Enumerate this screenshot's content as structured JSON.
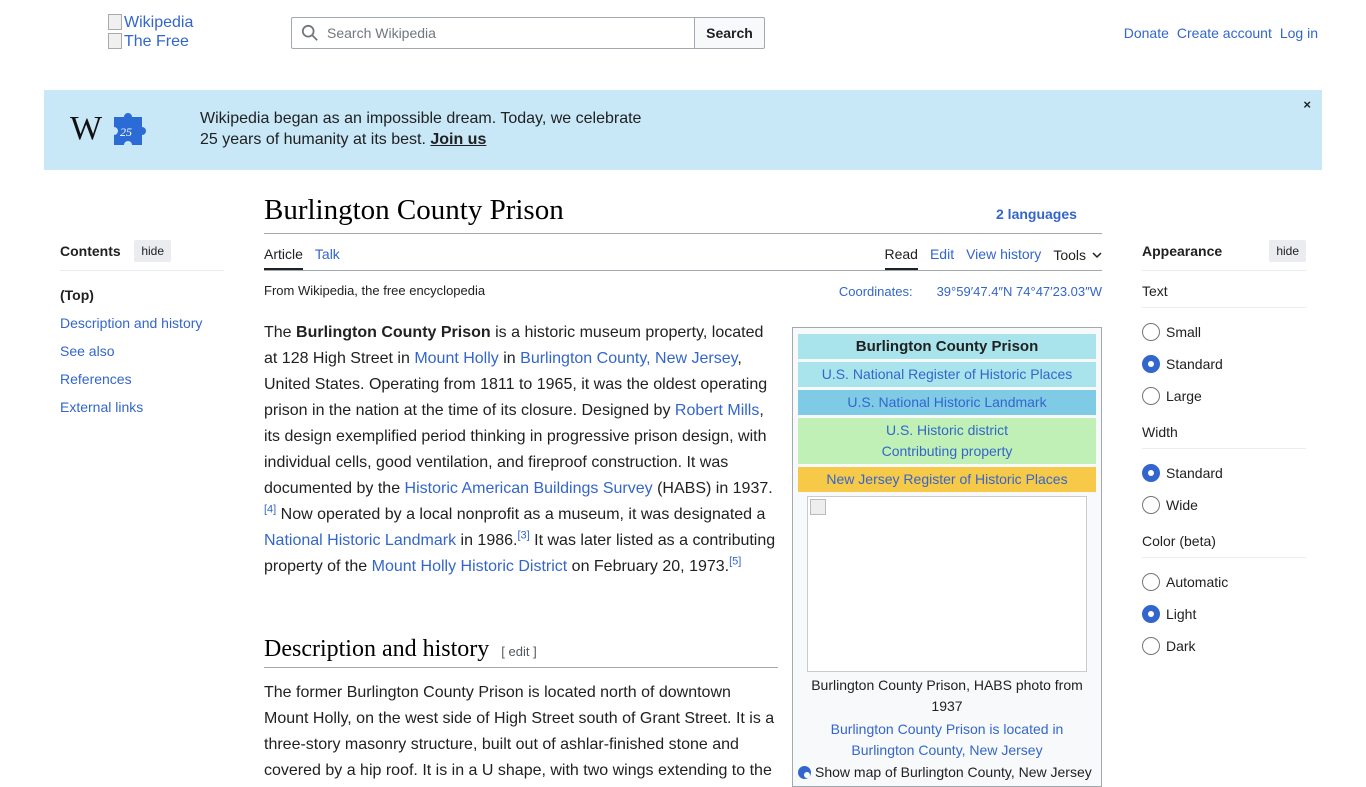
{
  "header": {
    "logo_alt_1": "Wikipedia",
    "logo_alt_2": "The Free",
    "search_placeholder": "Search Wikipedia",
    "search_button": "Search",
    "user_links": [
      "Donate",
      "Create account",
      "Log in"
    ]
  },
  "banner": {
    "line1": "Wikipedia began as an impossible dream. Today, we celebrate",
    "line2": "25 years of humanity at its best.",
    "join_link": "Join us",
    "close": "×",
    "logo_letter": "W",
    "logo_number": "25"
  },
  "toc": {
    "title": "Contents",
    "hide": "hide",
    "items": [
      "(Top)",
      "Description and history",
      "See also",
      "References",
      "External links"
    ]
  },
  "page": {
    "title": "Burlington County Prison",
    "languages": "2 languages",
    "tabs_left": [
      "Article",
      "Talk"
    ],
    "tabs_right": [
      "Read",
      "Edit",
      "View history",
      "Tools"
    ],
    "tagline": "From Wikipedia, the free encyclopedia",
    "coords_label": "Coordinates:",
    "coords_value": "39°59′47.4″N 74°47′23.03″W"
  },
  "article": {
    "p1": {
      "t1": "The ",
      "bold": "Burlington County Prison",
      "t2": " is a historic museum property, located at 128 High Street in ",
      "l1": "Mount Holly",
      "t3": " in ",
      "l2": "Burlington County, New Jersey",
      "t4": ", United States. Operating from 1811 to 1965, it was the oldest operating prison in the nation at the time of its closure. Designed by ",
      "l3": "Robert Mills",
      "t5": ", its design exemplified period thinking in progressive prison design, with individual cells, good ventilation, and fireproof construction. It was documented by the ",
      "l4": "Historic American Buildings Survey",
      "t6": " (HABS) in 1937.",
      "s1": "[4]",
      "t7": " Now operated by a local nonprofit as a museum, it was designated a ",
      "l5": "National Historic Landmark",
      "t8": " in 1986.",
      "s2": "[3]",
      "t9": " It was later listed as a contributing property of the ",
      "l6": "Mount Holly Historic District",
      "t10": " on February 20, 1973.",
      "s3": "[5]"
    },
    "section_title": "Description and history",
    "section_edit": "[ edit ]",
    "p2": "The former Burlington County Prison is located north of downtown Mount Holly, on the west side of High Street south of Grant Street. It is a three-story masonry structure, built out of ashlar-finished stone and covered by a hip roof. It is in a U shape, with two wings extending to the"
  },
  "infobox": {
    "title": "Burlington County Prison",
    "nrhp": "U.S. National Register of Historic Places",
    "nhl": "U.S. National Historic Landmark",
    "hd1": "U.S. Historic district",
    "hd2": "Contributing property",
    "nj": "New Jersey Register of Historic Places",
    "caption": "Burlington County Prison, HABS photo from 1937",
    "map_alt": "Burlington County Prison is located in Burlington County, New Jersey",
    "map_radio": "Show map of Burlington County, New Jersey"
  },
  "appearance": {
    "title": "Appearance",
    "hide": "hide",
    "groups": [
      {
        "label": "Text",
        "options": [
          "Small",
          "Standard",
          "Large"
        ],
        "selected": "Standard"
      },
      {
        "label": "Width",
        "options": [
          "Standard",
          "Wide"
        ],
        "selected": "Standard"
      },
      {
        "label": "Color (beta)",
        "options": [
          "Automatic",
          "Light",
          "Dark"
        ],
        "selected": "Light"
      }
    ]
  },
  "colors": {
    "link": "#3366cc",
    "banner_bg": "#c8e8f8",
    "infobox_title_bg": "#a9e4ec",
    "infobox_nhl_bg": "#7fcbe6",
    "infobox_hd_bg": "#c0f0b6",
    "infobox_nj_bg": "#f7c948"
  }
}
